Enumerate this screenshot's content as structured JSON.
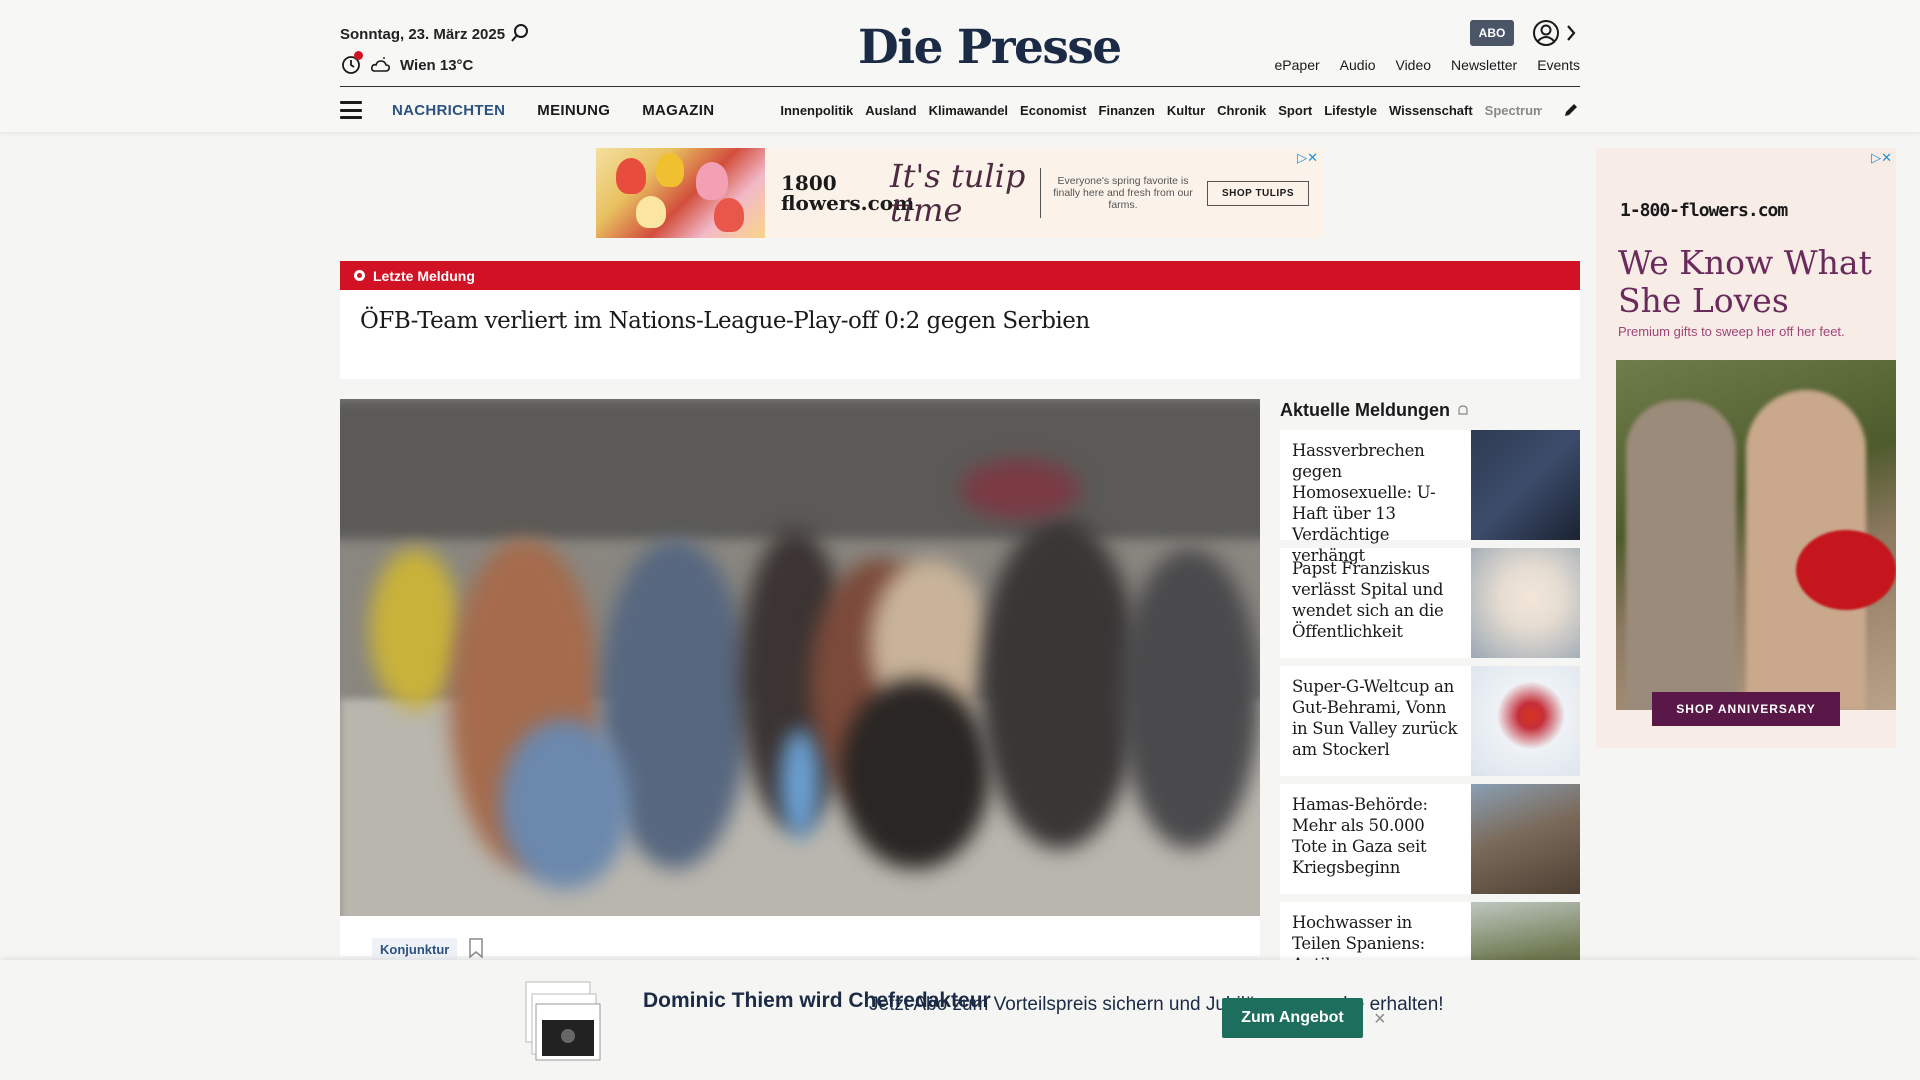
{
  "header": {
    "date": "Sonntag, 23. März 2025",
    "weather": "Wien 13°C",
    "logo": "Die Presse",
    "abo": "ABO",
    "top_links": [
      "ePaper",
      "Audio",
      "Video",
      "Newsletter",
      "Events"
    ]
  },
  "nav": {
    "main": [
      "NACHRICHTEN",
      "MEINUNG",
      "MAGAZIN"
    ],
    "sub": [
      "Innenpolitik",
      "Ausland",
      "Klimawandel",
      "Economist",
      "Finanzen",
      "Kultur",
      "Chronik",
      "Sport",
      "Lifestyle",
      "Wissenschaft",
      "Spectrum"
    ]
  },
  "ad_top": {
    "brand": "1800 flowers.com",
    "headline": "It's tulip time",
    "copy": "Everyone's spring favorite is finally here and fresh from our farms.",
    "button": "SHOP TULIPS"
  },
  "breaking": {
    "label": "Letzte Meldung",
    "headline": "ÖFB-Team verliert im Nations-League-Play-off 0:2 gegen Serbien"
  },
  "hero": {
    "tag": "Konjunktur"
  },
  "sidebar": {
    "title": "Aktuelle Meldungen",
    "items": [
      {
        "title": "Hassverbrechen gegen Homosexuelle: U-Haft über 13 Verdächtige verhängt"
      },
      {
        "title": "Papst Franziskus verlässt Spital und wendet sich an die Öffentlichkeit"
      },
      {
        "title": "Super-G-Weltcup an Gut-Behrami, Vonn in Sun Valley zurück am Stockerl"
      },
      {
        "title": "Hamas-Behörde: Mehr als 50.000 Tote in Gaza seit Kriegsbeginn"
      },
      {
        "title": "Hochwasser in Teilen Spaniens: Antike"
      }
    ]
  },
  "ad_side": {
    "brand": "1-800-flowers.com",
    "headline": "We Know What She Loves",
    "sub": "Premium gifts to sweep her off her feet.",
    "button": "SHOP ANNIVERSARY"
  },
  "promo": {
    "name": "Dominic Thiem wird Chefredakteur",
    "offer": "Jetzt Abo zum Vorteilspreis sichern und Jubiläumsausgabe erhalten!",
    "button": "Zum Angebot",
    "close": "×"
  },
  "colors": {
    "breaking_red": "#d11124",
    "nav_active": "#2c5282",
    "promo_button": "#1d6e5c",
    "logo": "#1b2a45"
  }
}
